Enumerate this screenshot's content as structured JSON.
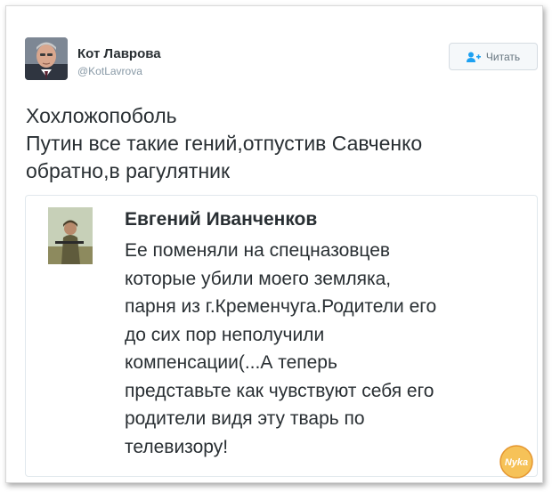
{
  "tweet": {
    "author_name": "Кот Лаврова",
    "author_handle": "@KotLavrova",
    "follow_label": "Читать",
    "text_lines": [
      "Хохложопоболь",
      "Путин все такие гений,отпустив Савченко",
      "обратно,в рагулятник"
    ]
  },
  "quoted": {
    "author_name": "Евгений Иванченков",
    "text_lines": [
      "Ее поменяли на спецназовцев",
      "которые убили моего земляка,",
      "парня из г.Кременчуга.Родители его",
      "до сих пор неполучили",
      "компенсации(...А теперь",
      "представьте как чувствуют себя его",
      "родители видя эту тварь по",
      "телевизору!"
    ]
  },
  "watermark": {
    "text": "Nyka"
  },
  "colors": {
    "text": "#292f33",
    "muted": "#8899a6",
    "follow_icon": "#1da1f2",
    "watermark": "#f4b73b"
  },
  "icons": [
    "add-user-icon",
    "avatar-photo",
    "watermark-logo"
  ]
}
